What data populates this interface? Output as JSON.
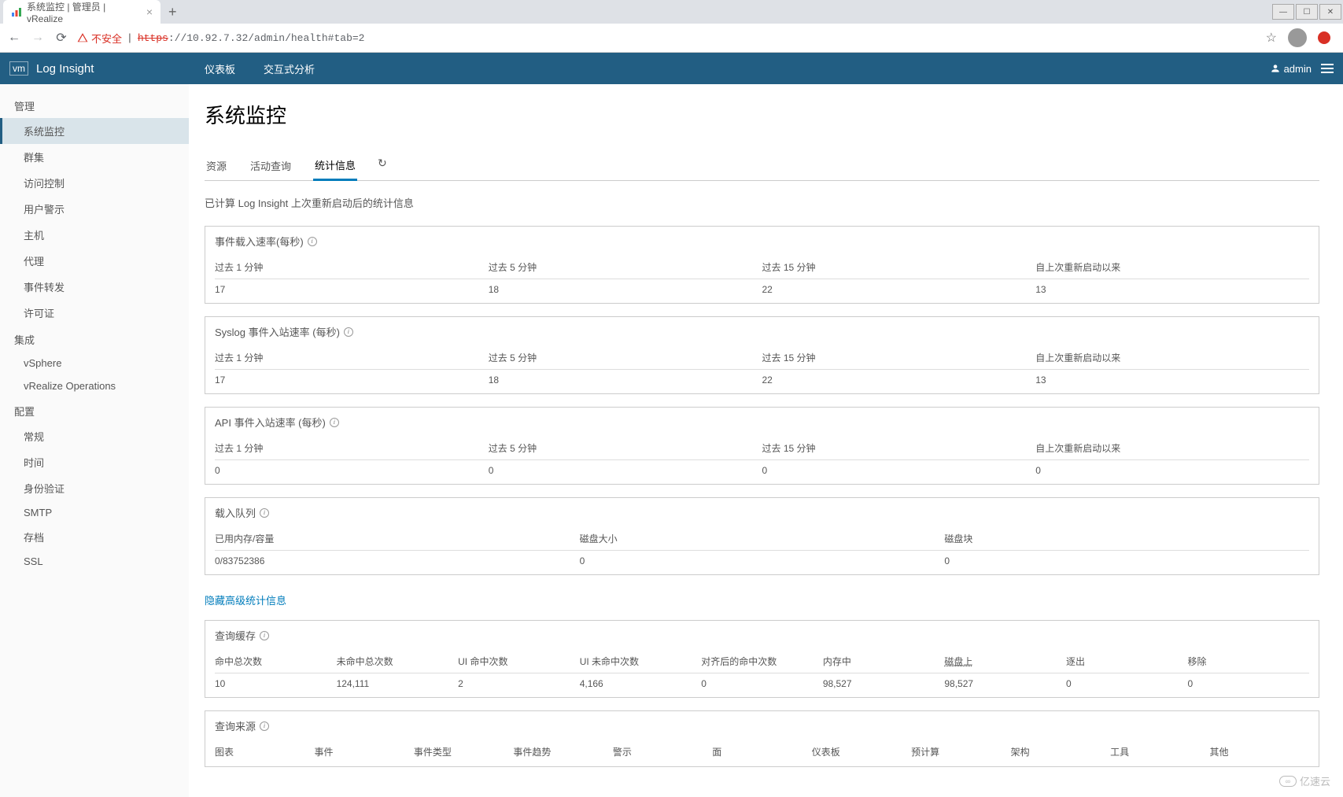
{
  "browser": {
    "tab_title": "系统监控 | 管理员 | vRealize",
    "new_tab": "+",
    "not_secure_label": "不安全",
    "url_scheme": "https",
    "url_rest": "://10.92.7.32/admin/health#tab=2",
    "window_controls": {
      "min": "—",
      "max": "☐",
      "close": "✕"
    }
  },
  "header": {
    "logo_mark": "vm",
    "logo_text": "Log Insight",
    "nav": {
      "dashboards": "仪表板",
      "interactive": "交互式分析"
    },
    "username": "admin"
  },
  "sidebar": {
    "groups": {
      "mgmt": {
        "title": "管理",
        "items": {
          "sysmon": "系统监控",
          "cluster": "群集",
          "access": "访问控制",
          "alerts": "用户警示",
          "hosts": "主机",
          "agents": "代理",
          "fwd": "事件转发",
          "license": "许可证"
        }
      },
      "integration": {
        "title": "集成",
        "items": {
          "vsphere": "vSphere",
          "vrops": "vRealize Operations"
        }
      },
      "config": {
        "title": "配置",
        "items": {
          "general": "常规",
          "time": "时间",
          "auth": "身份验证",
          "smtp": "SMTP",
          "archive": "存档",
          "ssl": "SSL"
        }
      }
    }
  },
  "main": {
    "title": "系统监控",
    "tabs": {
      "resources": "资源",
      "activeq": "活动查询",
      "stats": "统计信息"
    },
    "description": "已计算 Log Insight 上次重新启动后的统计信息",
    "col_headers": {
      "m1": "过去 1 分钟",
      "m5": "过去 5 分钟",
      "m15": "过去 15 分钟",
      "since": "自上次重新启动以来"
    },
    "panels": {
      "ingest_rate": {
        "title": "事件载入速率(每秒)",
        "values": {
          "m1": "17",
          "m5": "18",
          "m15": "22",
          "since": "13"
        }
      },
      "syslog_rate": {
        "title": "Syslog 事件入站速率 (每秒)",
        "values": {
          "m1": "17",
          "m5": "18",
          "m15": "22",
          "since": "13"
        }
      },
      "api_rate": {
        "title": "API 事件入站速率 (每秒)",
        "values": {
          "m1": "0",
          "m5": "0",
          "m15": "0",
          "since": "0"
        }
      },
      "ingest_queue": {
        "title": "载入队列",
        "headers": {
          "mem": "已用内存/容量",
          "disk_size": "磁盘大小",
          "disk_blocks": "磁盘块"
        },
        "values": {
          "mem": "0/83752386",
          "disk_size": "0",
          "disk_blocks": "0"
        }
      }
    },
    "link_hide": "隐藏高级统计信息",
    "query_cache": {
      "title": "查询缓存",
      "headers": {
        "hits": "命中总次数",
        "miss": "未命中总次数",
        "ui_hits": "UI 命中次数",
        "ui_miss": "UI 未命中次数",
        "unaligned": "对齐后的命中次数",
        "in_mem": "内存中",
        "on_disk": "磁盘上",
        "evict": "逐出",
        "remove": "移除"
      },
      "values": {
        "hits": "10",
        "miss": "124,111",
        "ui_hits": "2",
        "ui_miss": "4,166",
        "unaligned": "0",
        "in_mem": "98,527",
        "on_disk": "98,527",
        "evict": "0",
        "remove": "0"
      }
    },
    "query_source": {
      "title": "查询来源",
      "headers": {
        "chart": "图表",
        "event": "事件",
        "type": "事件类型",
        "trend": "事件趋势",
        "alert": "警示",
        "facet": "面",
        "dashboard": "仪表板",
        "precalc": "预计算",
        "schema": "架构",
        "tools": "工具",
        "other": "其他"
      }
    }
  },
  "watermark": "亿速云"
}
